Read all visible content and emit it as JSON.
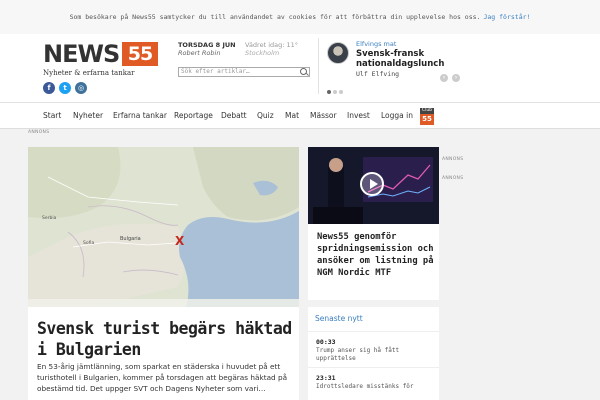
{
  "cookie": {
    "text": "Som besökare på News55 samtycker du till användandet av cookies för att förbättra din upplevelse hos oss.",
    "link": "Jag förstår!"
  },
  "brand": {
    "logo_text": "NEWS",
    "logo_number": "55",
    "tagline": "Nyheter & erfarna tankar",
    "accent_color": "#e05a25",
    "social": [
      {
        "name": "facebook",
        "glyph": "f"
      },
      {
        "name": "twitter",
        "glyph": "t"
      },
      {
        "name": "instagram",
        "glyph": "◎"
      }
    ]
  },
  "header": {
    "date": "TORSDAG 8 JUN",
    "author": "Robert Robin",
    "weather": "Vädret idag: 11°",
    "weather_city": "Stockholm",
    "search_placeholder": "Sök efter artiklar…"
  },
  "column": {
    "label": "Elfvings mat",
    "title": "Svensk-fransk nationaldagslunch",
    "author": "Ulf Elfving"
  },
  "nav": {
    "items": [
      "Start",
      "Nyheter",
      "Erfarna tankar",
      "Reportage",
      "Debatt",
      "Quiz",
      "Mat",
      "Mässor",
      "Invest",
      "Logga in"
    ],
    "club_top": "Club",
    "club_number": "55"
  },
  "ads": {
    "label": "ANNONS"
  },
  "main_article": {
    "title": "Svensk turist begärs häktad i Bulgarien",
    "lead": "En 53-årig jämtlänning, som sparkat en städerska i huvudet på ett turisthotell i Bulgarien, kommer på torsdagen att begäras häktad på obestämd tid. Det uppger SVT och Dagens Nyheter som vari…",
    "map_labels": [
      "Serbia",
      "Bulgaria",
      "Sofia"
    ],
    "marker": "X"
  },
  "video_article": {
    "title": "News55 genomför spridningsemission och ansöker om listning på NGM Nordic MTF"
  },
  "latest": {
    "title": "Senaste nytt",
    "items": [
      {
        "time": "00:33",
        "text": "Trump anser sig hå fått upprättelse"
      },
      {
        "time": "23:31",
        "text": "Idrottsledare misstänks för"
      }
    ]
  }
}
